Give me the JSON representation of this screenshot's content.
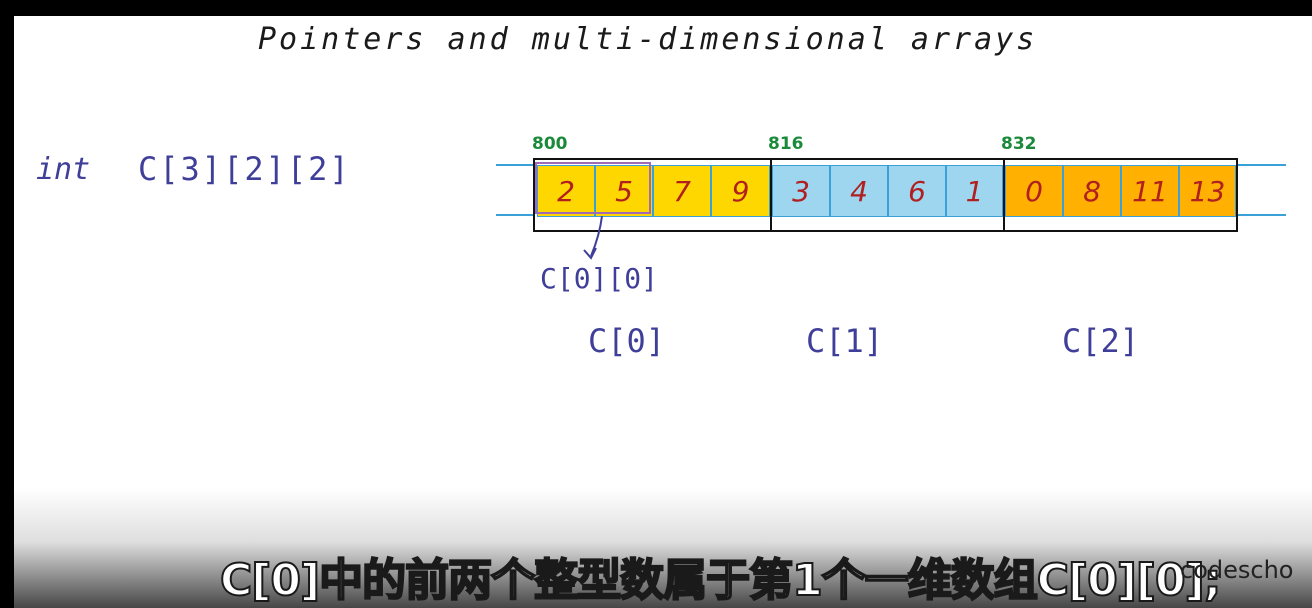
{
  "board": {
    "title": "Pointers and multi-dimensional arrays",
    "declaration": {
      "type": "int",
      "name": "C[3][2][2]"
    }
  },
  "array": {
    "blocks": [
      {
        "address": "800",
        "label": "C[0]",
        "cells": [
          "2",
          "5",
          "7",
          "9"
        ],
        "color": "#ffd700"
      },
      {
        "address": "816",
        "label": "C[1]",
        "cells": [
          "3",
          "4",
          "6",
          "1"
        ],
        "color": "#9fd6ef"
      },
      {
        "address": "832",
        "label": "C[2]",
        "cells": [
          "0",
          "8",
          "11",
          "13"
        ],
        "color": "#ffb000"
      }
    ],
    "pointer_label": "C[0][0]"
  },
  "subtitle": "C[0]中的前两个整型数属于第1个一维数组C[0][0];",
  "watermark": "codescho",
  "colors": {
    "rail": "#3aa0d8",
    "highlight": "#a06ab6",
    "address": "#1a8a3a",
    "handwriting": "#3f3f9a",
    "digits": "#b02020"
  }
}
